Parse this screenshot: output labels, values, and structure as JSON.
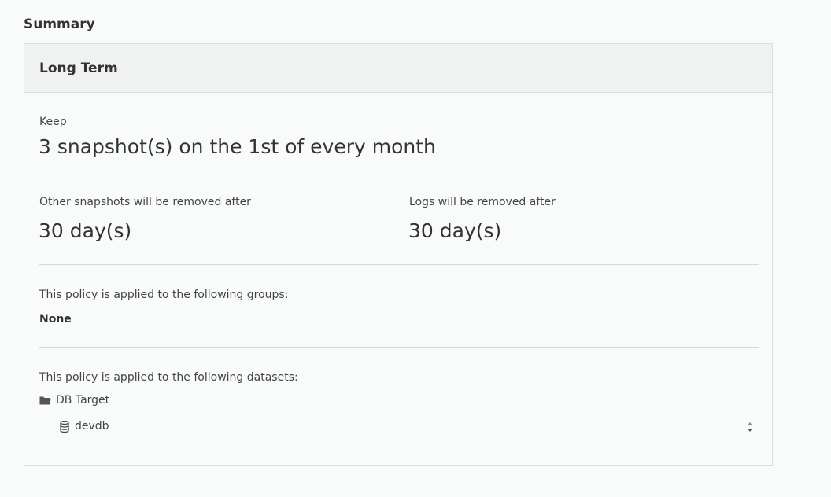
{
  "summary": {
    "title": "Summary"
  },
  "card": {
    "header": "Long Term",
    "keep_label": "Keep",
    "keep_value": "3 snapshot(s) on the 1st of every month",
    "other_label": "Other snapshots will be removed after",
    "other_value": "30 day(s)",
    "logs_label": "Logs will be removed after",
    "logs_value": "30 day(s)",
    "groups_label": "This policy is applied to the following groups:",
    "groups_value": "None",
    "datasets_label": "This policy is applied to the following datasets:",
    "tree": {
      "folder": {
        "label": "DB Target",
        "icon": "folder-icon"
      },
      "database": {
        "label": "devdb",
        "icon": "database-icon"
      }
    }
  },
  "colors": {
    "background": "#f8fbfa",
    "header_background": "#f0f2f1",
    "border": "#dcdedd",
    "text": "#333333"
  }
}
